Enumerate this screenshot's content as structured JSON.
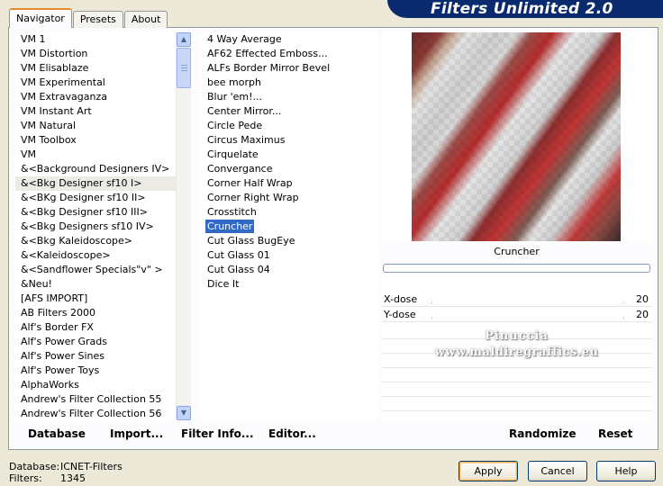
{
  "app": {
    "title": "Filters Unlimited 2.0"
  },
  "tabs": [
    {
      "label": "Navigator",
      "active": true
    },
    {
      "label": "Presets",
      "active": false
    },
    {
      "label": "About",
      "active": false
    }
  ],
  "categories": {
    "items": [
      "VM 1",
      "VM Distortion",
      "VM Elisablaze",
      "VM Experimental",
      "VM Extravaganza",
      "VM Instant Art",
      "VM Natural",
      "VM Toolbox",
      "VM",
      "&<Background Designers IV>",
      "&<Bkg Designer sf10 I>",
      "&<BKg Designer sf10 II>",
      "&<Bkg Designer sf10 III>",
      "&<Bkg Designers sf10 IV>",
      "&<Bkg Kaleidoscope>",
      "&<Kaleidoscope>",
      "&<Sandflower Specials\"v\" >",
      "&Neu!",
      "[AFS IMPORT]",
      "AB Filters 2000",
      "Alf's Border FX",
      "Alf's Power Grads",
      "Alf's Power Sines",
      "Alf's Power Toys",
      "AlphaWorks",
      "Andrew's Filter Collection 55",
      "Andrew's Filter Collection 56"
    ],
    "selected_index": 10
  },
  "filters": {
    "items": [
      "4 Way Average",
      "AF62 Effected Emboss...",
      "ALFs Border Mirror Bevel",
      "bee morph",
      "Blur 'em!...",
      "Center Mirror...",
      "Circle Pede",
      "Circus Maximus",
      "Cirquelate",
      "Convergance",
      "Corner Half Wrap",
      "Corner Right Wrap",
      "Crosstitch",
      "Cruncher",
      "Cut Glass  BugEye",
      "Cut Glass 01",
      "Cut Glass 04",
      "Dice It"
    ],
    "selected_index": 13
  },
  "preview": {
    "filter_name": "Cruncher",
    "progress": 0,
    "watermark_line1": "Pinuccia",
    "watermark_line2": "www.maldiregraffics.eu"
  },
  "params": [
    {
      "label": "X-dose",
      "value": "20"
    },
    {
      "label": "Y-dose",
      "value": "20"
    }
  ],
  "toolbar": {
    "database": "Database",
    "import": "Import...",
    "filter_info": "Filter Info...",
    "editor": "Editor...",
    "randomize": "Randomize",
    "reset": "Reset"
  },
  "status": {
    "database_label": "Database:",
    "database_value": "ICNET-Filters",
    "filters_label": "Filters:",
    "filters_value": "1345"
  },
  "buttons": {
    "apply": "Apply",
    "cancel": "Cancel",
    "help": "Help"
  },
  "colors": {
    "banner": "#0a2a6e",
    "selection": "#316ac5",
    "tab_accent": "#e68b2c"
  }
}
